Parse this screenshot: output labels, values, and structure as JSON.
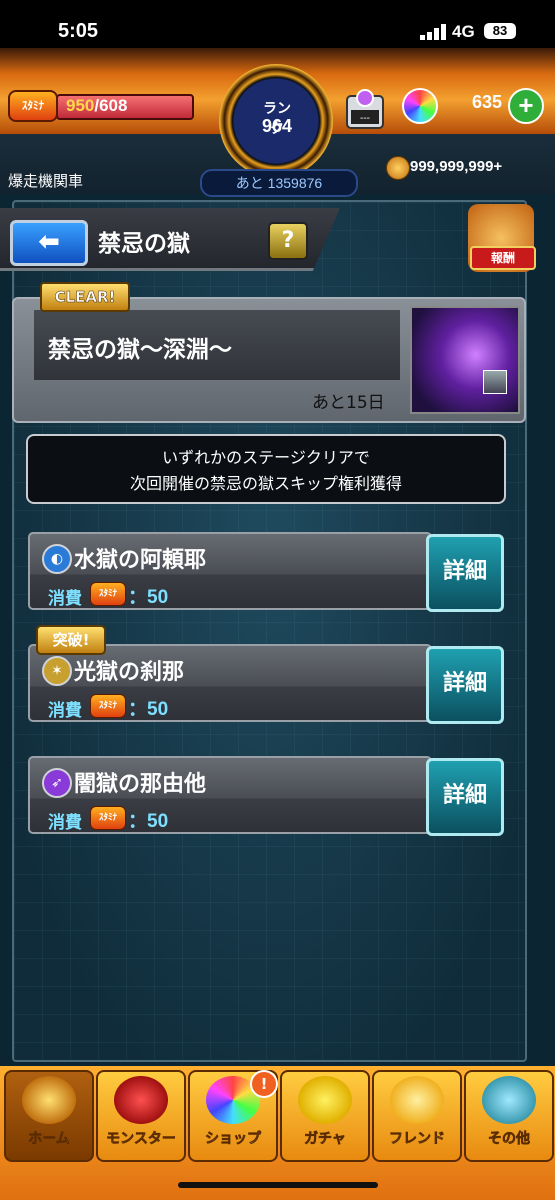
{
  "status_bar": {
    "time": "5:05",
    "network": "4G",
    "battery": "83"
  },
  "header": {
    "stamina_label": "ｽﾀﾐﾅ",
    "stamina_current": "950",
    "stamina_max": "/608",
    "rank_label": "ランク",
    "rank_value": "964",
    "rank_next": "あと 1359876",
    "box_label": "---",
    "orb_count": "635",
    "username": "爆走機関車",
    "coins": "999,999,999+"
  },
  "page": {
    "title": "禁忌の獄",
    "help_label": "?",
    "back_label": "⬅",
    "reward_label": "報酬"
  },
  "event": {
    "clear_badge": "CLEAR!",
    "title": "禁忌の獄～深淵～",
    "remaining": "あと15日"
  },
  "notice": {
    "line1": "いずれかのステージクリアで",
    "line2": "次回開催の禁忌の獄スキップ権利獲得"
  },
  "stages": [
    {
      "name": "水獄の阿頼耶",
      "cost_label": "消費",
      "cost_icon": "ｽﾀﾐﾅ",
      "cost": "：50",
      "detail": "詳細",
      "element_color": "#2a7ad8",
      "element_icon": "water-element-icon"
    },
    {
      "name": "光獄の刹那",
      "cost_label": "消費",
      "cost_icon": "ｽﾀﾐﾅ",
      "cost": "：50",
      "detail": "詳細",
      "element_color": "#c8a030",
      "element_icon": "light-element-icon",
      "badge": "突破!"
    },
    {
      "name": "闇獄の那由他",
      "cost_label": "消費",
      "cost_icon": "ｽﾀﾐﾅ",
      "cost": "：50",
      "detail": "詳細",
      "element_color": "#8a3ad8",
      "element_icon": "dark-element-icon"
    }
  ],
  "bottom_nav": [
    {
      "label": "ホーム",
      "icon": "home-icon"
    },
    {
      "label": "モンスター",
      "icon": "monster-icon"
    },
    {
      "label": "ショップ",
      "icon": "shop-icon",
      "alert": "!"
    },
    {
      "label": "ガチャ",
      "icon": "gacha-icon"
    },
    {
      "label": "フレンド",
      "icon": "friend-icon"
    },
    {
      "label": "その他",
      "icon": "other-icon"
    }
  ]
}
